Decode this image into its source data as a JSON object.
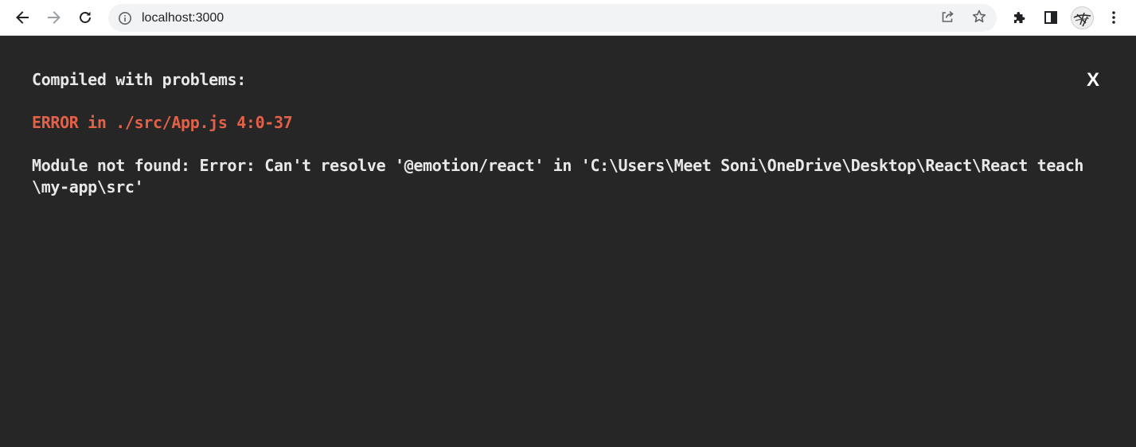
{
  "browser": {
    "url": "localhost:3000",
    "icons": {
      "back": "arrow-left-icon",
      "forward": "arrow-right-icon",
      "reload": "reload-icon",
      "site_info": "info-icon",
      "share": "share-icon",
      "bookmark": "star-icon",
      "extensions": "puzzle-icon",
      "side_panel": "side-panel-icon",
      "menu": "kebab-menu-icon"
    }
  },
  "overlay": {
    "header": "Compiled with problems:",
    "close_label": "X",
    "errors": [
      {
        "title": "ERROR in ./src/App.js 4:0-37",
        "message": "Module not found: Error: Can't resolve '@emotion/react' in 'C:\\Users\\Meet Soni\\OneDrive\\Desktop\\React\\React teach\\my-app\\src'"
      }
    ]
  },
  "colors": {
    "overlay_bg": "#262626",
    "error_red": "#e36049",
    "text": "#e8e8e8",
    "toolbar_bg": "#ffffff",
    "omnibox_bg": "#f1f3f4"
  }
}
